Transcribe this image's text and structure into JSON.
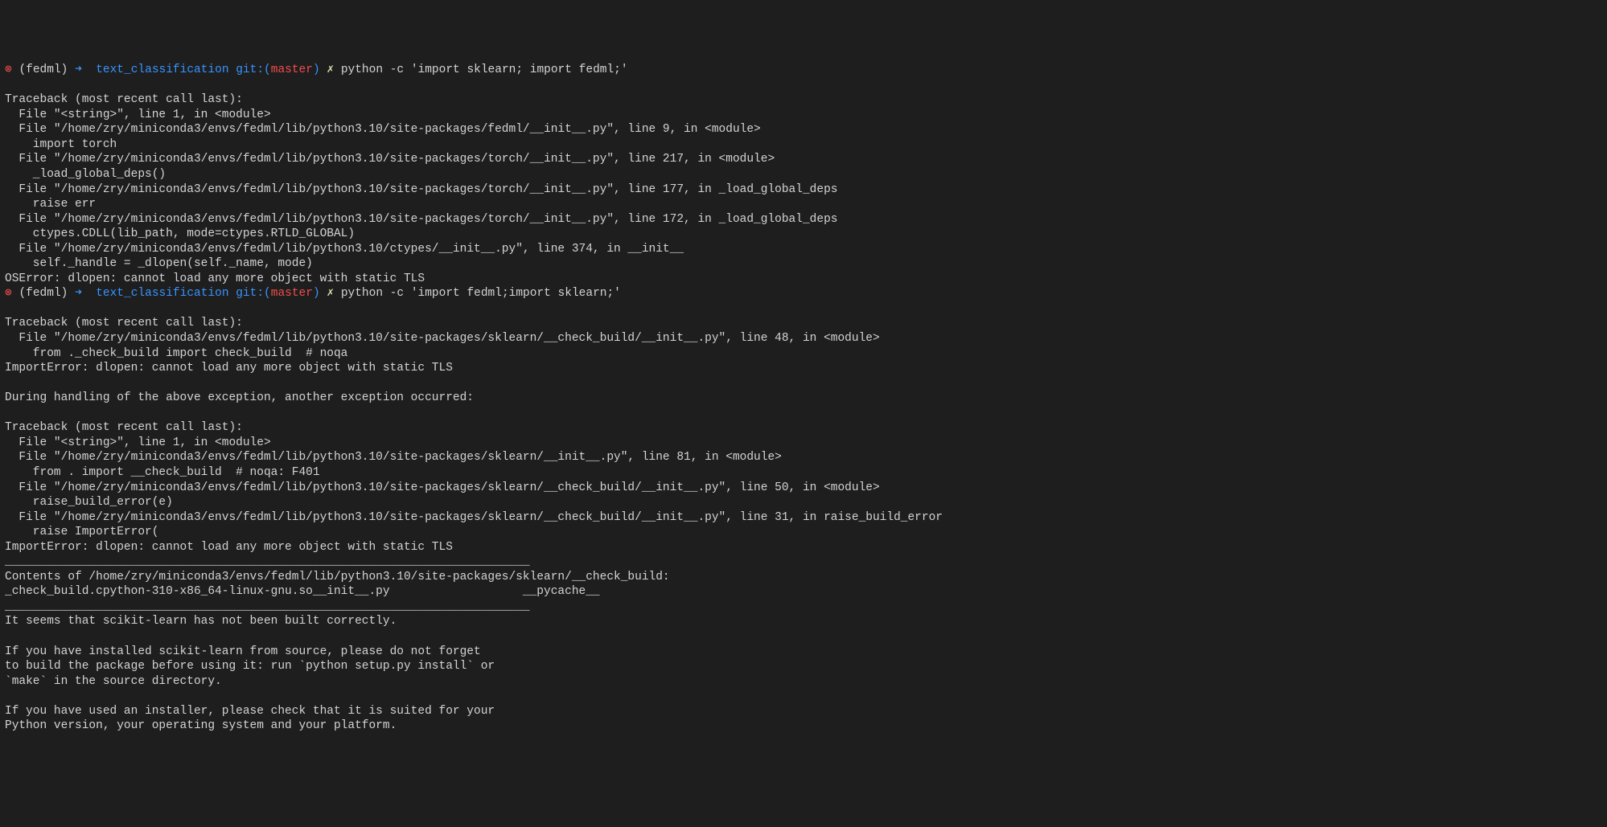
{
  "prompt1": {
    "err": "⊗",
    "env": "(fedml)",
    "arrow": "➜",
    "dir": "text_classification",
    "git": "git:",
    "lp": "(",
    "branch": "master",
    "rp": ")",
    "x": "✗",
    "cmd": "python -c 'import sklearn; import fedml;'"
  },
  "out1": [
    "Traceback (most recent call last):",
    "  File \"<string>\", line 1, in <module>",
    "  File \"/home/zry/miniconda3/envs/fedml/lib/python3.10/site-packages/fedml/__init__.py\", line 9, in <module>",
    "    import torch",
    "  File \"/home/zry/miniconda3/envs/fedml/lib/python3.10/site-packages/torch/__init__.py\", line 217, in <module>",
    "    _load_global_deps()",
    "  File \"/home/zry/miniconda3/envs/fedml/lib/python3.10/site-packages/torch/__init__.py\", line 177, in _load_global_deps",
    "    raise err",
    "  File \"/home/zry/miniconda3/envs/fedml/lib/python3.10/site-packages/torch/__init__.py\", line 172, in _load_global_deps",
    "    ctypes.CDLL(lib_path, mode=ctypes.RTLD_GLOBAL)",
    "  File \"/home/zry/miniconda3/envs/fedml/lib/python3.10/ctypes/__init__.py\", line 374, in __init__",
    "    self._handle = _dlopen(self._name, mode)",
    "OSError: dlopen: cannot load any more object with static TLS"
  ],
  "prompt2": {
    "err": "⊗",
    "env": "(fedml)",
    "arrow": "➜",
    "dir": "text_classification",
    "git": "git:",
    "lp": "(",
    "branch": "master",
    "rp": ")",
    "x": "✗",
    "cmd": "python -c 'import fedml;import sklearn;'"
  },
  "out2": [
    "Traceback (most recent call last):",
    "  File \"/home/zry/miniconda3/envs/fedml/lib/python3.10/site-packages/sklearn/__check_build/__init__.py\", line 48, in <module>",
    "    from ._check_build import check_build  # noqa",
    "ImportError: dlopen: cannot load any more object with static TLS",
    "",
    "During handling of the above exception, another exception occurred:",
    "",
    "Traceback (most recent call last):",
    "  File \"<string>\", line 1, in <module>",
    "  File \"/home/zry/miniconda3/envs/fedml/lib/python3.10/site-packages/sklearn/__init__.py\", line 81, in <module>",
    "    from . import __check_build  # noqa: F401",
    "  File \"/home/zry/miniconda3/envs/fedml/lib/python3.10/site-packages/sklearn/__check_build/__init__.py\", line 50, in <module>",
    "    raise_build_error(e)",
    "  File \"/home/zry/miniconda3/envs/fedml/lib/python3.10/site-packages/sklearn/__check_build/__init__.py\", line 31, in raise_build_error",
    "    raise ImportError(",
    "ImportError: dlopen: cannot load any more object with static TLS",
    "___________________________________________________________________________",
    "Contents of /home/zry/miniconda3/envs/fedml/lib/python3.10/site-packages/sklearn/__check_build:",
    "_check_build.cpython-310-x86_64-linux-gnu.so__init__.py                   __pycache__",
    "___________________________________________________________________________",
    "It seems that scikit-learn has not been built correctly.",
    "",
    "If you have installed scikit-learn from source, please do not forget",
    "to build the package before using it: run `python setup.py install` or",
    "`make` in the source directory.",
    "",
    "If you have used an installer, please check that it is suited for your",
    "Python version, your operating system and your platform."
  ]
}
